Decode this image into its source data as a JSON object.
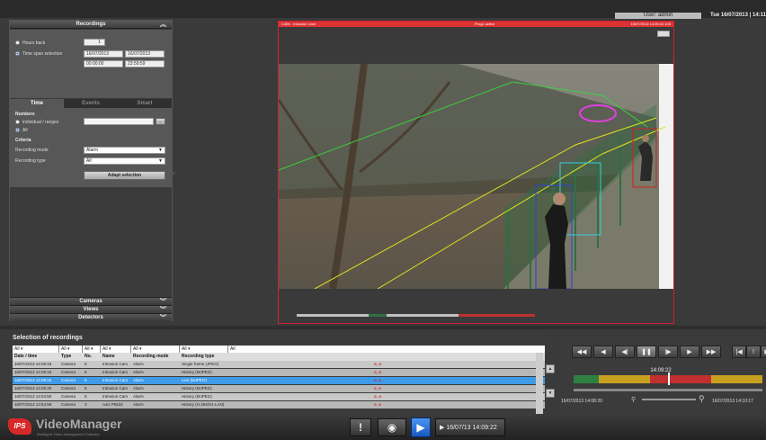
{
  "header": {
    "user_label": "User: admin",
    "datetime": "Tue 16/07/2013 | 14:11"
  },
  "recordings_panel": {
    "title": "Recordings",
    "hours_back_label": "Hours back",
    "hours_back_value": "1",
    "time_span_label": "Time span selection",
    "from_date": "16/07/2013",
    "to_date": "16/07/2013",
    "from_time": "00:00:00",
    "to_time": "23:59:59",
    "tabs": [
      "Time",
      "Events",
      "Smart"
    ],
    "numbers_heading": "Numbers",
    "individual_label": "individual / ranges",
    "all_label": "All",
    "criteria_heading": "Criteria",
    "recording_mode_label": "Recording mode",
    "recording_mode_value": "Alarm",
    "recording_type_label": "Recording type",
    "recording_type_value": "All",
    "adapt_button": "Adapt selection",
    "cameras_header": "Cameras",
    "views_header": "Views",
    "detectors_header": "Detectors"
  },
  "camera": {
    "header_left": "C406 - Intrusion Cam",
    "header_mid": "Prog1 active",
    "header_right": "16/07/2013 14:09:22.105"
  },
  "selection": {
    "title": "Selection of recordings",
    "filters": [
      "All",
      "All",
      "All",
      "All",
      "All",
      "All",
      "All"
    ],
    "columns": [
      "Date / time",
      "Type",
      "No.",
      "Name",
      "Recording mode",
      "Recording type"
    ],
    "rows": [
      [
        "16/07/2013 14:09:16",
        "Camera",
        "6",
        "Intrusion Cam",
        "Alarm",
        "Single frame (JPEG)"
      ],
      [
        "16/07/2013 14:09:16",
        "Camera",
        "6",
        "Intrusion Cam",
        "Alarm",
        "History (MJPEG)"
      ],
      [
        "16/07/2013 14:09:16",
        "Camera",
        "6",
        "Intrusion Cam",
        "Alarm",
        "Live (MJPEG)"
      ],
      [
        "16/07/2013 14:05:30",
        "Camera",
        "6",
        "Intrusion Cam",
        "Alarm",
        "History (MJPEG)"
      ],
      [
        "16/07/2013 14:04:50",
        "Camera",
        "6",
        "Intrusion Cam",
        "Alarm",
        "History (MJPEG)"
      ],
      [
        "16/07/2013 13:54:58",
        "Camera",
        "3",
        "Axis P5534",
        "Alarm",
        "History (H.264/S1-LAN)"
      ]
    ],
    "selected_row": 2
  },
  "playback": {
    "buttons": [
      "◀◀",
      "◀",
      "◀|",
      "❚❚",
      "|▶",
      "▶",
      "▶▶",
      "|◀",
      "!",
      "▶|"
    ],
    "current_time": "14:09:22",
    "start_label": "16/07/2013 14:08:20",
    "end_label": "16/07/2013 14:10:17",
    "position": 0.5
  },
  "footer": {
    "brand": "VideoManager",
    "tagline": "Intelligent Video Management Software",
    "logo": "IPS",
    "play_time": "16/07/13  14:09:22"
  },
  "colors": {
    "accent": "#2a7ad8",
    "alert": "#d02030",
    "selected_row": "#3f9ae8"
  }
}
